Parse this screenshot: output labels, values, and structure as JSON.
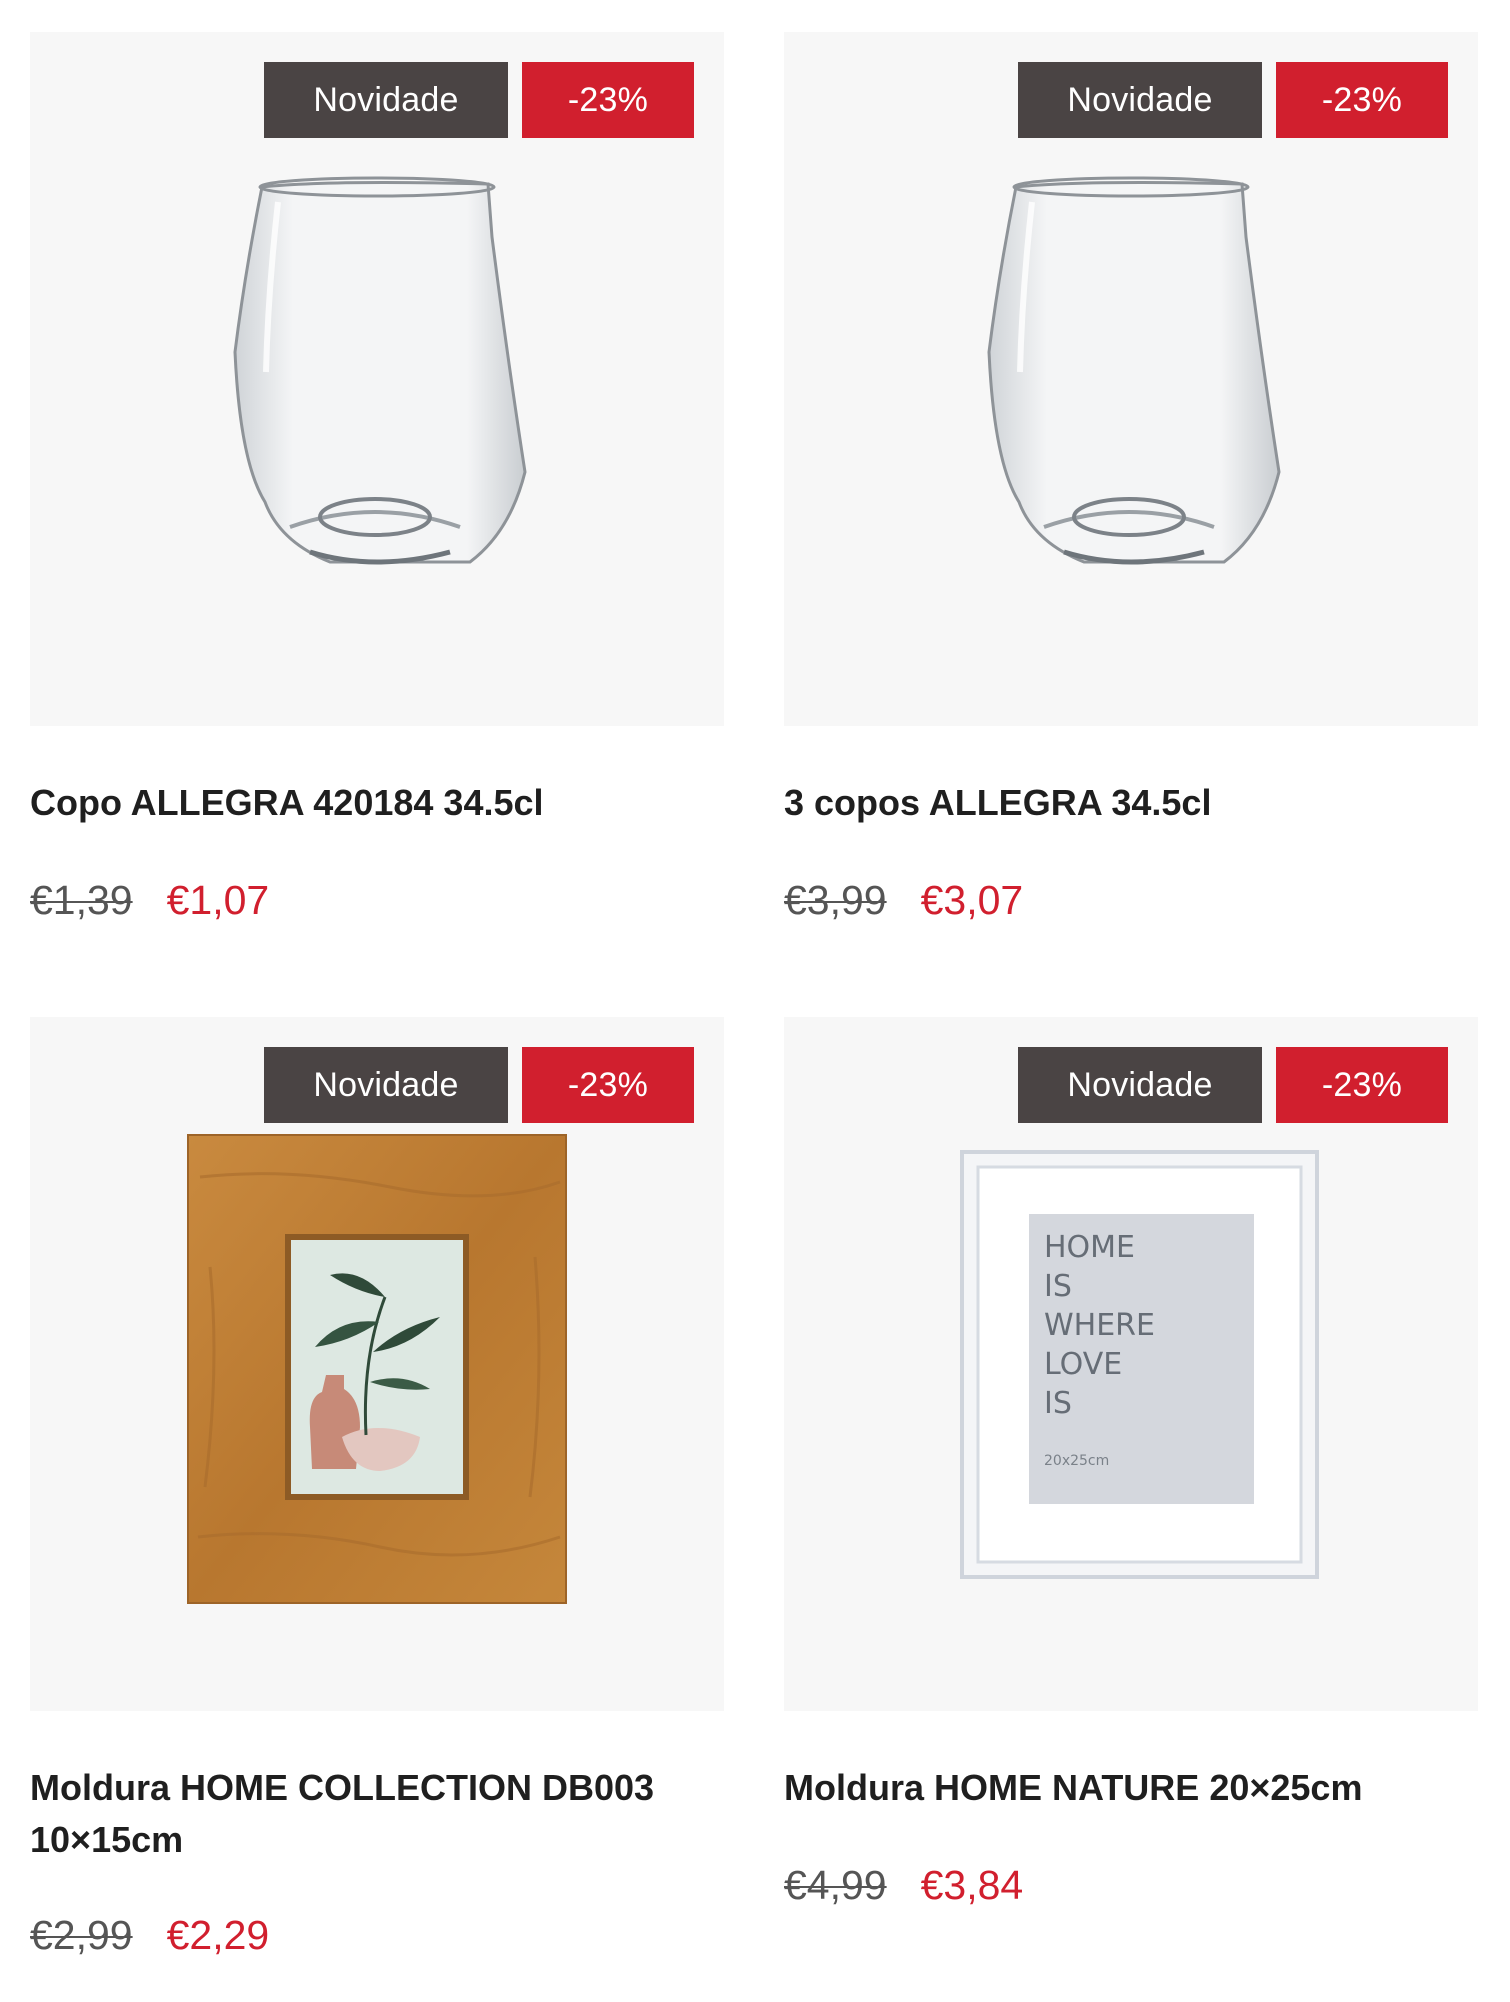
{
  "products": [
    {
      "badge_new": "Novidade",
      "badge_discount": "-23%",
      "title": "Copo ALLEGRA 420184 34.5cl",
      "old_price": "€1,39",
      "price": "€1,07",
      "image": "glass"
    },
    {
      "badge_new": "Novidade",
      "badge_discount": "-23%",
      "title": "3 copos ALLEGRA 34.5cl",
      "old_price": "€3,99",
      "price": "€3,07",
      "image": "glass"
    },
    {
      "badge_new": "Novidade",
      "badge_discount": "-23%",
      "title": "Moldura HOME COLLECTION DB003 10×15cm",
      "old_price": "€2,99",
      "price": "€2,29",
      "image": "wooden-frame"
    },
    {
      "badge_new": "Novidade",
      "badge_discount": "-23%",
      "title": "Moldura HOME NATURE 20×25cm",
      "old_price": "€4,99",
      "price": "€3,84",
      "image": "white-frame",
      "frame_text": {
        "line1": "HOME",
        "line2": "IS",
        "line3": "WHERE",
        "line4": "LOVE",
        "line5": "IS",
        "size": "20x25cm"
      }
    }
  ],
  "colors": {
    "badge_new_bg": "#4a4444",
    "badge_discount_bg": "#d11f2e",
    "sale_price": "#d11f2e",
    "card_bg": "#f7f7f7"
  }
}
